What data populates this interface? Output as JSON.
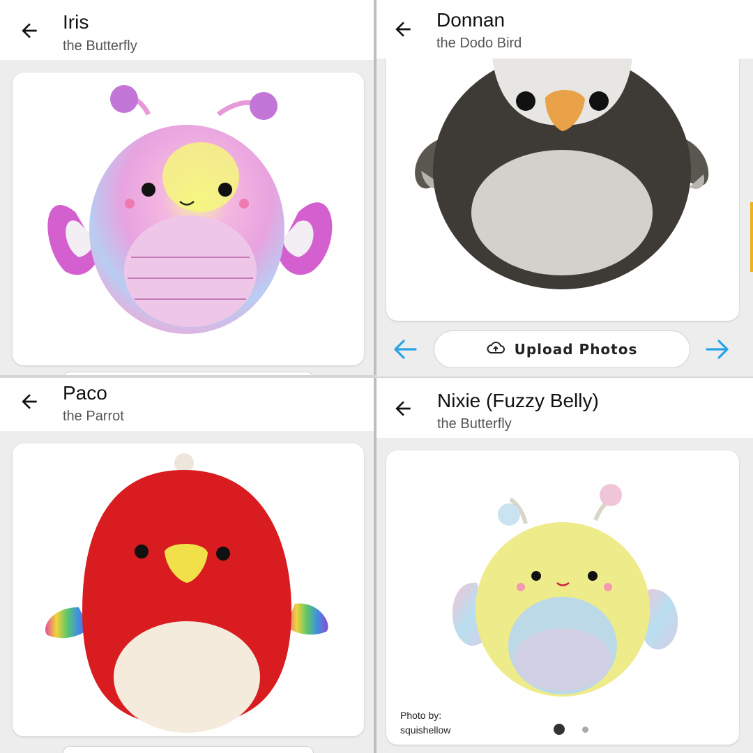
{
  "panels": [
    {
      "title": "Iris",
      "subtitle": "the Butterfly"
    },
    {
      "title": "Donnan",
      "subtitle": "the Dodo Bird",
      "upload_label": "Upload Photos"
    },
    {
      "title": "Paco",
      "subtitle": "the Parrot"
    },
    {
      "title": "Nixie (Fuzzy Belly)",
      "subtitle": "the Butterfly",
      "credit_line1": "Photo by:",
      "credit_line2": "squishellow"
    }
  ],
  "carousel": {
    "current_page": 1,
    "total_pages": 2
  },
  "colors": {
    "accent_arrow": "#29a3e6",
    "title_text": "#111111",
    "subtitle_text": "#555555"
  }
}
